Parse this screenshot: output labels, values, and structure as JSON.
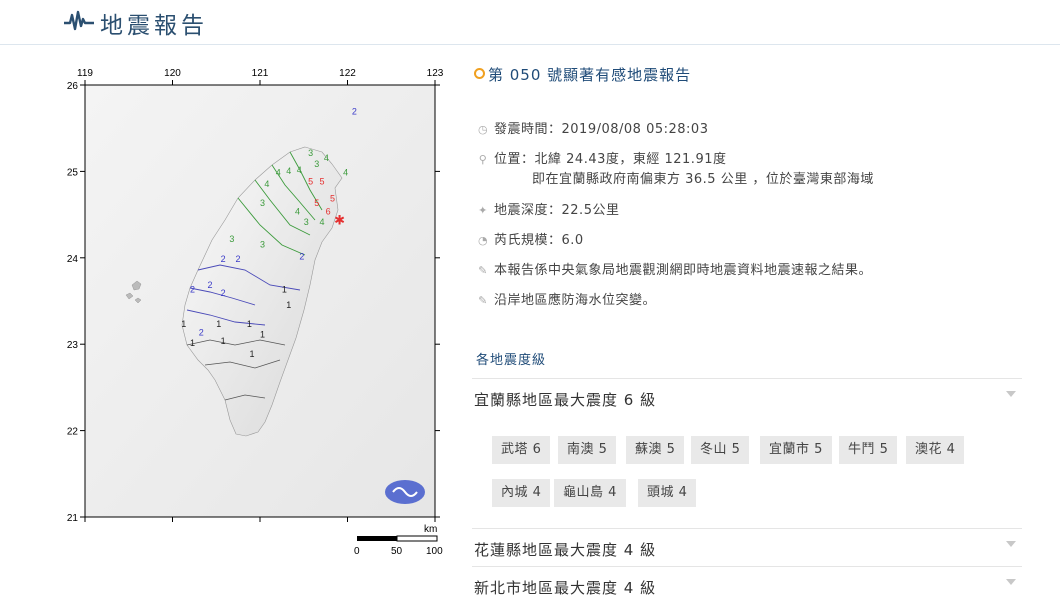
{
  "header": {
    "title": "地震報告"
  },
  "map": {
    "lon_ticks": [
      "119",
      "120",
      "121",
      "122",
      "123"
    ],
    "lat_ticks": [
      "26",
      "25",
      "24",
      "23",
      "22",
      "21"
    ],
    "scale_unit": "km",
    "scale_labels": [
      "0",
      "50",
      "100"
    ],
    "epicenter_color": "#e53030",
    "intensity_colors": {
      "1": "#222222",
      "2": "#3a3ac8",
      "3": "#3c9b3c",
      "4": "#3c9b3c",
      "5": "#e53030",
      "6": "#e53030"
    },
    "markers": [
      {
        "v": "2",
        "lon": 122.05,
        "lat": 25.66
      },
      {
        "v": "3",
        "lon": 121.55,
        "lat": 25.18
      },
      {
        "v": "3",
        "lon": 121.62,
        "lat": 25.05
      },
      {
        "v": "4",
        "lon": 121.73,
        "lat": 25.12
      },
      {
        "v": "4",
        "lon": 121.42,
        "lat": 24.98
      },
      {
        "v": "4",
        "lon": 121.3,
        "lat": 24.97
      },
      {
        "v": "4",
        "lon": 121.18,
        "lat": 24.95
      },
      {
        "v": "4",
        "lon": 121.05,
        "lat": 24.82
      },
      {
        "v": "3",
        "lon": 121.0,
        "lat": 24.6
      },
      {
        "v": "4",
        "lon": 121.95,
        "lat": 24.95
      },
      {
        "v": "4",
        "lon": 121.4,
        "lat": 24.5
      },
      {
        "v": "3",
        "lon": 121.5,
        "lat": 24.38
      },
      {
        "v": "4",
        "lon": 121.68,
        "lat": 24.38
      },
      {
        "v": "3",
        "lon": 120.65,
        "lat": 24.18
      },
      {
        "v": "3",
        "lon": 121.0,
        "lat": 24.12
      },
      {
        "v": "2",
        "lon": 120.55,
        "lat": 23.95
      },
      {
        "v": "2",
        "lon": 120.72,
        "lat": 23.95
      },
      {
        "v": "2",
        "lon": 121.45,
        "lat": 23.98
      },
      {
        "v": "2",
        "lon": 120.2,
        "lat": 23.6
      },
      {
        "v": "2",
        "lon": 120.4,
        "lat": 23.65
      },
      {
        "v": "2",
        "lon": 120.55,
        "lat": 23.56
      },
      {
        "v": "2",
        "lon": 120.3,
        "lat": 23.1
      },
      {
        "v": "1",
        "lon": 121.25,
        "lat": 23.6
      },
      {
        "v": "1",
        "lon": 121.3,
        "lat": 23.42
      },
      {
        "v": "1",
        "lon": 120.1,
        "lat": 23.2
      },
      {
        "v": "1",
        "lon": 120.2,
        "lat": 22.98
      },
      {
        "v": "1",
        "lon": 120.5,
        "lat": 23.2
      },
      {
        "v": "1",
        "lon": 120.55,
        "lat": 23.0
      },
      {
        "v": "1",
        "lon": 120.85,
        "lat": 23.2
      },
      {
        "v": "1",
        "lon": 121.0,
        "lat": 23.08
      },
      {
        "v": "1",
        "lon": 120.88,
        "lat": 22.85
      },
      {
        "v": "5",
        "lon": 121.55,
        "lat": 24.85
      },
      {
        "v": "5",
        "lon": 121.68,
        "lat": 24.85
      },
      {
        "v": "5",
        "lon": 121.62,
        "lat": 24.6
      },
      {
        "v": "5",
        "lon": 121.8,
        "lat": 24.65
      },
      {
        "v": "6",
        "lon": 121.75,
        "lat": 24.5
      }
    ]
  },
  "report": {
    "title": "第 050 號顯著有感地震報告",
    "time_label": "發震時間：",
    "time_value": "2019/08/08 05:28:03",
    "location_label": "位置：",
    "location_value": "北緯 24.43度，東經 121.91度",
    "location_desc": "即在宜蘭縣政府南偏東方 36.5 公里 ，位於臺灣東部海域",
    "depth_label": "地震深度：",
    "depth_value": "22.5公里",
    "magnitude_label": "芮氏規模：",
    "magnitude_value": "6.0",
    "note1": "本報告係中央氣象局地震觀測網即時地震資料地震速報之結果。",
    "note2": "沿岸地區應防海水位突變。"
  },
  "intensity_section": {
    "title": "各地震度級",
    "counties": [
      {
        "label": "宜蘭縣地區最大震度 6 級"
      },
      {
        "label": "花蓮縣地區最大震度 4 級"
      },
      {
        "label": "新北市地區最大震度 4 級"
      }
    ],
    "yilan_towns": [
      "武塔 6",
      "南澳 5",
      "蘇澳 5",
      "冬山 5",
      "宜蘭市 5",
      "牛鬥 5",
      "澳花 4",
      "內城 4",
      "龜山島 4",
      "頭城 4"
    ]
  }
}
